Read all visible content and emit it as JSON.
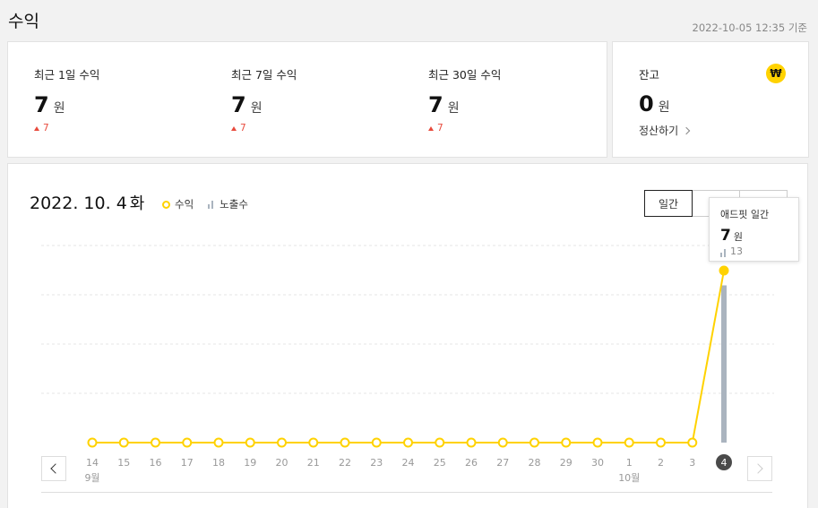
{
  "page": {
    "title": "수익",
    "timestamp": "2022-10-05 12:35 기준"
  },
  "stats": [
    {
      "label": "최근 1일 수익",
      "value": "7",
      "unit": "원",
      "delta": "7"
    },
    {
      "label": "최근 7일 수익",
      "value": "7",
      "unit": "원",
      "delta": "7"
    },
    {
      "label": "최근 30일 수익",
      "value": "7",
      "unit": "원",
      "delta": "7"
    }
  ],
  "balance": {
    "label": "잔고",
    "value": "0",
    "unit": "원",
    "icon": "won-coin-icon",
    "icon_glyph": "₩",
    "link_label": "정산하기"
  },
  "chart_panel": {
    "date": "2022. 10. 4",
    "weekday": "화",
    "legend_revenue": "수익",
    "legend_impressions": "노출수",
    "tabs": [
      "일간",
      "",
      ""
    ],
    "prev_icon": "chevron-left-icon",
    "next_icon": "chevron-right-icon"
  },
  "tooltip": {
    "title": "애드핏 일간",
    "value": "7",
    "unit": "원",
    "impressions": "13"
  },
  "colors": {
    "revenue_line": "#ffd200",
    "impressions_bar": "#aab4bf",
    "delta_up": "#e84a3c",
    "selected_day_badge": "#4a4a4a"
  },
  "chart_data": {
    "type": "line",
    "x": [
      "14",
      "15",
      "16",
      "17",
      "18",
      "19",
      "20",
      "21",
      "22",
      "23",
      "24",
      "25",
      "26",
      "27",
      "28",
      "29",
      "30",
      "1",
      "2",
      "3",
      "4"
    ],
    "month_labels": [
      {
        "at_index": 0,
        "label": "9월"
      },
      {
        "at_index": 17,
        "label": "10월"
      }
    ],
    "selected_index": 20,
    "series": [
      {
        "name": "수익",
        "type": "line",
        "values": [
          0,
          0,
          0,
          0,
          0,
          0,
          0,
          0,
          0,
          0,
          0,
          0,
          0,
          0,
          0,
          0,
          0,
          0,
          0,
          0,
          7
        ]
      },
      {
        "name": "노출수",
        "type": "bar",
        "values": [
          0,
          0,
          0,
          0,
          0,
          0,
          0,
          0,
          0,
          0,
          0,
          0,
          0,
          0,
          0,
          0,
          0,
          0,
          0,
          0,
          13
        ]
      }
    ],
    "revenue_range": [
      0,
      7
    ],
    "impressions_range": [
      0,
      16
    ],
    "grid": true
  }
}
